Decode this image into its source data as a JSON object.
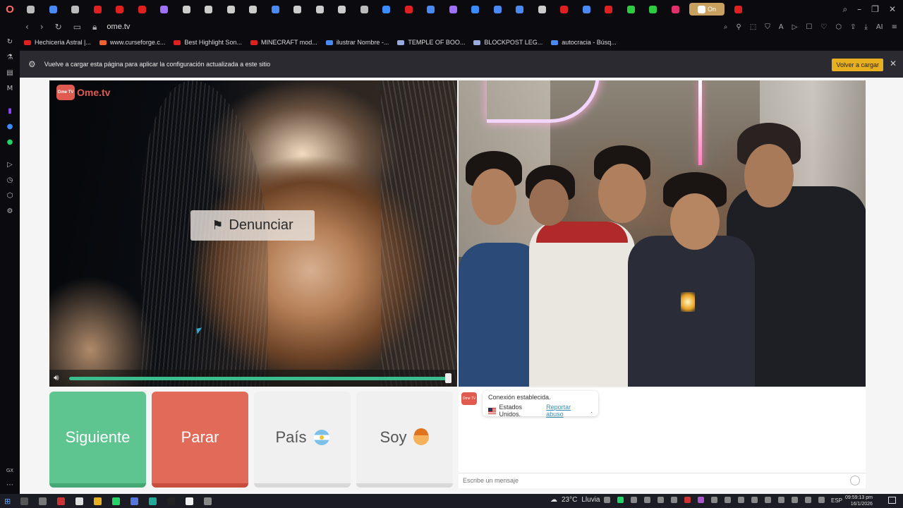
{
  "browser": {
    "tabs_count": 36,
    "active_tab_label": "On",
    "address": "ome.tv",
    "bookmarks": [
      {
        "label": "Hechiceria Astral |...",
        "color": "#e02020"
      },
      {
        "label": "www.curseforge.c...",
        "color": "#f06030"
      },
      {
        "label": "Best Highlight Son...",
        "color": "#e02020"
      },
      {
        "label": "MINECRAFT mod...",
        "color": "#e02020"
      },
      {
        "label": "ilustrar Nombre -...",
        "color": "#4a8af4"
      },
      {
        "label": "TEMPLE OF BOO...",
        "color": "#9ad"
      },
      {
        "label": "BLOCKPOST LEG...",
        "color": "#9ad"
      },
      {
        "label": "autocracia - Búsq...",
        "color": "#4a8af4"
      }
    ],
    "sidebar_label_gx": "GX"
  },
  "infobar": {
    "message": "Vuelve a cargar esta página para aplicar la configuración actualizada a este sitio",
    "reload_button": "Volver a cargar",
    "close": "✕"
  },
  "ometv": {
    "logo_text": "Ome.tv",
    "logo_badge": "Ome TV",
    "report_label": "Denunciar",
    "volume_level": 1.0,
    "buttons": {
      "next": "Siguiente",
      "stop": "Parar",
      "country": "País",
      "gender": "Soy"
    },
    "chat": {
      "status_line": "Conexión establecida.",
      "country_line": "Estados Unidos.",
      "report_abuse": "Reportar abuso",
      "input_placeholder": "Escribe un mensaje"
    },
    "colors": {
      "next": "#5ec490",
      "stop": "#e26a58",
      "accent": "#3bbd8e"
    }
  },
  "taskbar": {
    "weather_temp": "23°C",
    "weather_desc": "Lluvia",
    "language": "ESP",
    "time": "09:59:13 pm",
    "date": "16/1/2026"
  }
}
